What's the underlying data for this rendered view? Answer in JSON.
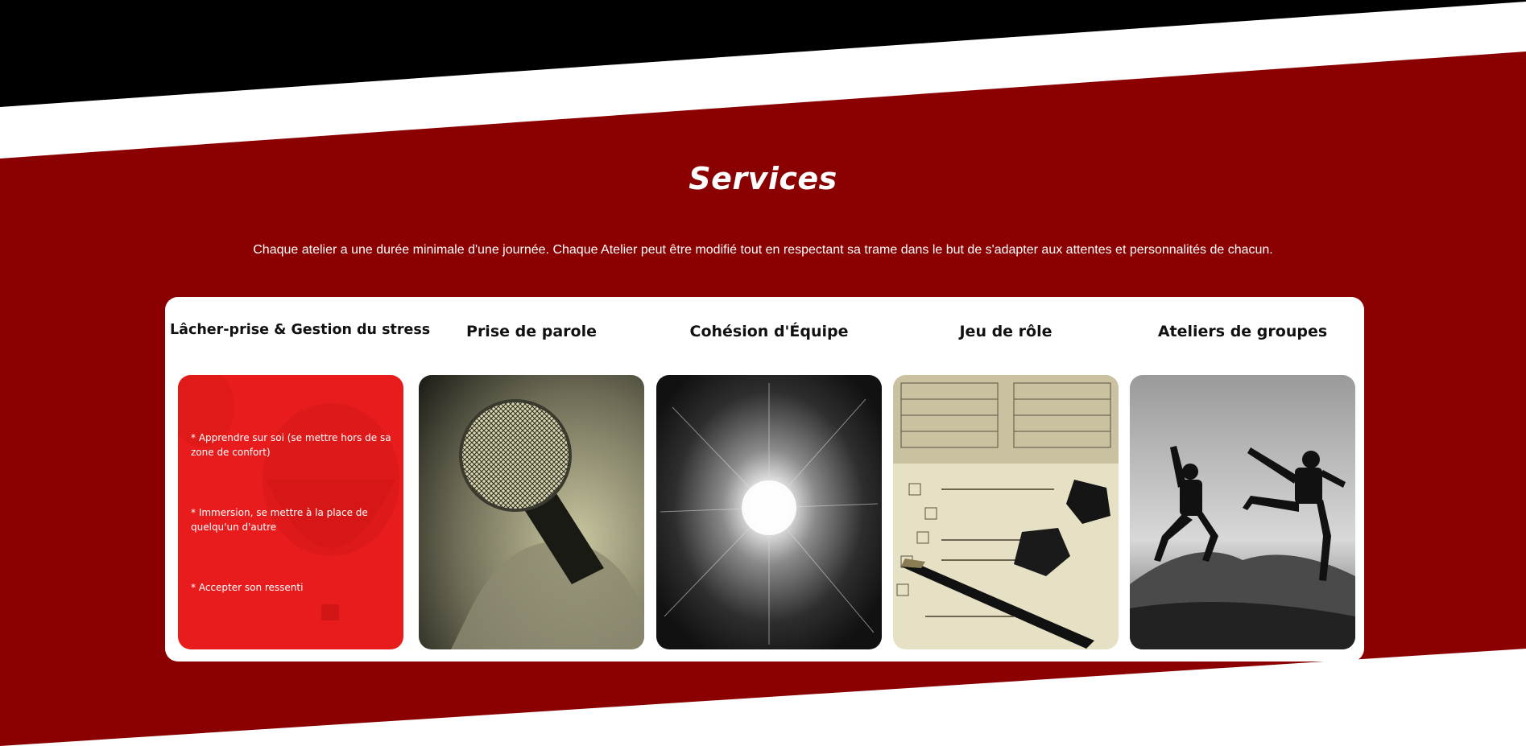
{
  "section": {
    "title": "Services",
    "intro": "Chaque atelier a une durée minimale d'une journée. Chaque Atelier peut être modifié tout en respectant sa trame dans le but de s'adapter aux attentes et personnalités de chacun."
  },
  "colors": {
    "band_dark_red": "#8b0000",
    "band_black": "#000000",
    "card_red": "#e81c1c",
    "panel_white": "#ffffff"
  },
  "services": [
    {
      "title": "Lâcher-prise & Gestion du stress",
      "image": "hot-air-balloon-image",
      "bullets": [
        "* Apprendre sur soi (se mettre hors de sa zone de confort)",
        "* Immersion, se mettre à la place de quelqu'un d'autre",
        "* Accepter son ressenti"
      ]
    },
    {
      "title": "Prise de parole",
      "image": "microphone-image"
    },
    {
      "title": "Cohésion d'Équipe",
      "image": "explosion-light-image"
    },
    {
      "title": "Jeu de rôle",
      "image": "dice-character-sheet-image"
    },
    {
      "title": "Ateliers de groupes",
      "image": "jumping-people-image"
    }
  ]
}
